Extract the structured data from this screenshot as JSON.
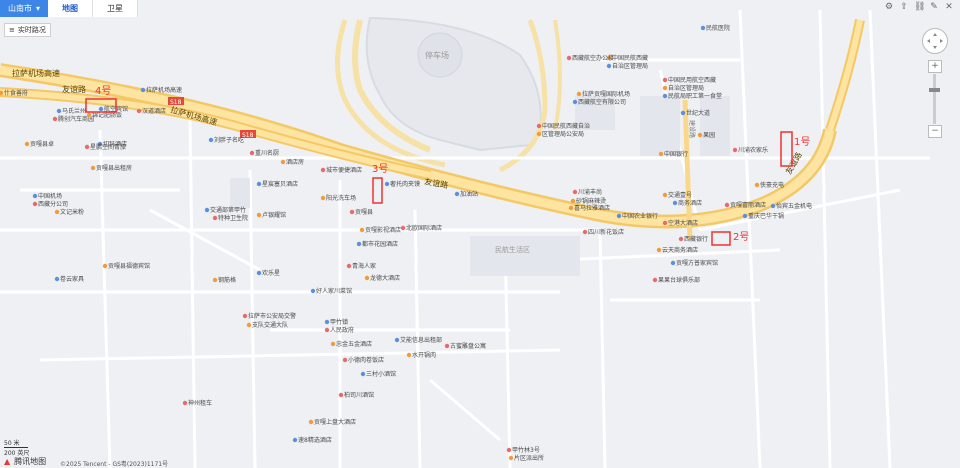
{
  "city_selector": {
    "label": "山南市"
  },
  "tabs": [
    {
      "label": "地图"
    },
    {
      "label": "卫星"
    }
  ],
  "traffic_label": "实时路况",
  "scale": {
    "top": "50 米",
    "bottom": "200 英尺"
  },
  "brand": "腾讯地图",
  "copyright": "©2025 Tencent - GS粤(2023)1171号",
  "roads": [
    {
      "label": "拉萨机场高速"
    },
    {
      "label": "友谊路"
    },
    {
      "label": "拉萨机场高速"
    },
    {
      "label": "友谊路"
    },
    {
      "label": "友谊路"
    },
    {
      "label": "停车场"
    },
    {
      "label": "民航生活区"
    },
    {
      "label": "建设路"
    },
    {
      "label": "S18"
    },
    {
      "label": "S18"
    }
  ],
  "markers": [
    {
      "label": "4号"
    },
    {
      "label": "3号"
    },
    {
      "label": "2号"
    },
    {
      "label": "1号"
    }
  ],
  "pois": [
    {
      "label": "什食善府"
    },
    {
      "label": "马氏兰州"
    },
    {
      "label": "腾创汽车商园"
    },
    {
      "label": "锦记肥肠饭"
    },
    {
      "label": "拉萨机场高速"
    },
    {
      "label": "汉道酒店"
    },
    {
      "label": "贡嘎县卓"
    },
    {
      "label": "切玛酒店"
    },
    {
      "label": "星鹏空间青旅"
    },
    {
      "label": "贡嘎县出租房"
    },
    {
      "label": "中国机场"
    },
    {
      "label": "西藏分公司"
    },
    {
      "label": "文记米粉"
    },
    {
      "label": "交通部第甲竹"
    },
    {
      "label": "特种卫生院"
    },
    {
      "label": "卢银耀馆"
    },
    {
      "label": "刘胖子名吃"
    },
    {
      "label": "重川名厨"
    },
    {
      "label": "酒店房"
    },
    {
      "label": "星宸塞贝酒店"
    },
    {
      "label": "城市便捷酒店"
    },
    {
      "label": "阳光洗车场"
    },
    {
      "label": "奢托肉夹馍"
    },
    {
      "label": "贡嘎县"
    },
    {
      "label": "贡嘎影视酒店"
    },
    {
      "label": "都市花园酒店"
    },
    {
      "label": "北欧国际酒店"
    },
    {
      "label": "喜马拉雅酒店"
    },
    {
      "label": "加油站"
    },
    {
      "label": "青海人家"
    },
    {
      "label": "龙德大酒店"
    },
    {
      "label": "好人家川菜馆"
    },
    {
      "label": "拉萨市公安局交警"
    },
    {
      "label": "支队交通大队"
    },
    {
      "label": "甲竹镇"
    },
    {
      "label": "人民政府"
    },
    {
      "label": "忠金五金酒店"
    },
    {
      "label": "艾能信息出租部"
    },
    {
      "label": "小德肉卷饭店"
    },
    {
      "label": "水开锅肉"
    },
    {
      "label": "三村小酒馆"
    },
    {
      "label": "柏司川酒馆"
    },
    {
      "label": "贡嘎上盘大酒店"
    },
    {
      "label": "速8精选酒店"
    },
    {
      "label": "神州租车"
    },
    {
      "label": "贡嘎县福德宾馆"
    },
    {
      "label": "卷云家具"
    },
    {
      "label": "古蜜雕盘公寓"
    },
    {
      "label": "钢筋格"
    },
    {
      "label": "欢乐星"
    },
    {
      "label": "川渝丰尚"
    },
    {
      "label": "砂锅麻辣烫"
    },
    {
      "label": "中国农业银行"
    },
    {
      "label": "四川新花饭店"
    },
    {
      "label": "交通壹号"
    },
    {
      "label": "商务酒店"
    },
    {
      "label": "西藏银行"
    },
    {
      "label": "中国银行"
    },
    {
      "label": "重庆巴华干锅"
    },
    {
      "label": "贡嘎富丽酒店"
    },
    {
      "label": "云天商务酒店"
    },
    {
      "label": "贡嘎方普家宾馆"
    },
    {
      "label": "果果台球俱乐部"
    },
    {
      "label": "中国民航西藏"
    },
    {
      "label": "自治区管理局"
    },
    {
      "label": "西藏航空办公楼"
    },
    {
      "label": "拉萨贡嘎国际机场"
    },
    {
      "label": "西藏航空有限公司"
    },
    {
      "label": "中国民航西藏自治"
    },
    {
      "label": "区管理局公安局"
    },
    {
      "label": "民航医院"
    },
    {
      "label": "中国民用航空西藏"
    },
    {
      "label": "自治区管理局"
    },
    {
      "label": "民航局职工第一食堂"
    },
    {
      "label": "川渝农家乐"
    },
    {
      "label": "侠豪充电"
    },
    {
      "label": "怡宾五金机电"
    },
    {
      "label": "甲竹林3号"
    },
    {
      "label": "片区派出所"
    },
    {
      "label": "航空宾馆"
    },
    {
      "label": "空港大酒店"
    },
    {
      "label": "果园"
    },
    {
      "label": "世纪大道"
    }
  ]
}
